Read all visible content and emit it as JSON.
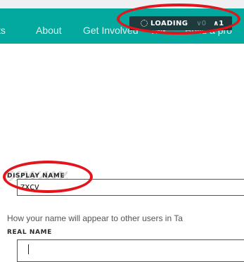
{
  "nav": {
    "items": [
      "ts",
      "About",
      "Get Involved",
      "Talk",
      "Build a pro"
    ]
  },
  "status": {
    "loading_label": "LOADING",
    "down_count": "∨0",
    "up_count": "∧1"
  },
  "form": {
    "display_name_label": "DISPLAY NAME",
    "display_name_value": "zxcv",
    "display_name_help": "How your name will appear to other users in Ta",
    "real_name_label": "REAL NAME",
    "real_name_value": ""
  },
  "colors": {
    "navbar": "#03a89e",
    "annotation": "#e3141b"
  }
}
